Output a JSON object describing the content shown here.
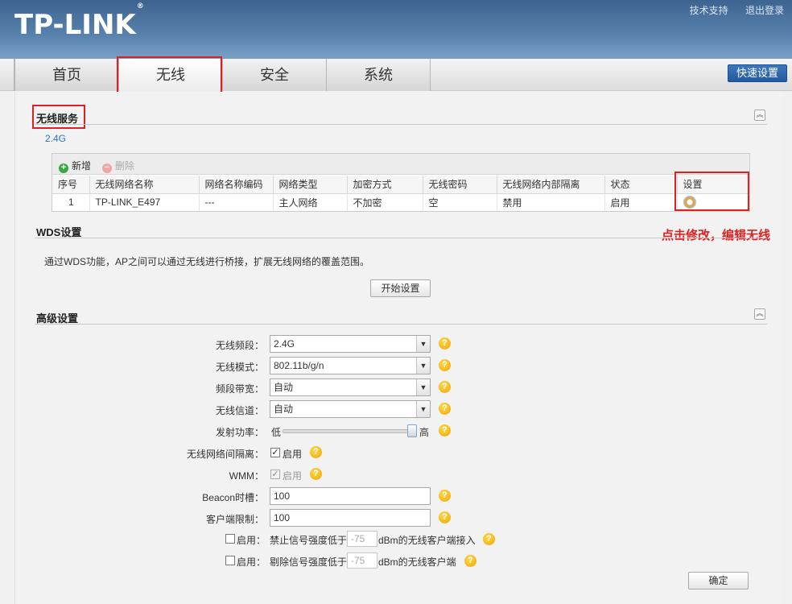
{
  "header": {
    "logo": "TP-LINK",
    "logo_mark": "®",
    "links": [
      "技术支持",
      "退出登录"
    ]
  },
  "nav": {
    "tabs": [
      "首页",
      "无线",
      "安全",
      "系统"
    ],
    "active": "无线",
    "quick_setup": "快速设置"
  },
  "wireless_service": {
    "title": "无线服务",
    "band": "2.4G",
    "toolbar": {
      "add": "新增",
      "delete": "删除"
    },
    "columns": [
      "序号",
      "无线网络名称",
      "网络名称编码",
      "网络类型",
      "加密方式",
      "无线密码",
      "无线网络内部隔离",
      "状态",
      "设置"
    ],
    "rows": [
      {
        "index": "1",
        "ssid": "TP-LINK_E497",
        "ssid_encoding": "---",
        "network_type": "主人网络",
        "encryption": "不加密",
        "password": "空",
        "isolation": "禁用",
        "status": "启用"
      }
    ]
  },
  "annotation": "点击修改，编辑无线",
  "wds": {
    "title": "WDS设置",
    "description": "通过WDS功能，AP之间可以通过无线进行桥接，扩展无线网络的覆盖范围。",
    "start_button": "开始设置"
  },
  "advanced": {
    "title": "高级设置",
    "band_label": "无线频段：",
    "band_value": "2.4G",
    "mode_label": "无线模式：",
    "mode_value": "802.11b/g/n",
    "width_label": "频段带宽：",
    "width_value": "自动",
    "channel_label": "无线信道：",
    "channel_value": "自动",
    "power_label": "发射功率：",
    "power_low": "低",
    "power_high": "高",
    "power_level": 0.95,
    "isolation_label": "无线网络间隔离：",
    "isolation_enabled": true,
    "isolation_text": "启用",
    "wmm_label": "WMM：",
    "wmm_enabled": true,
    "wmm_text": "启用",
    "beacon_label": "Beacon时槽：",
    "beacon_value": "100",
    "client_limit_label": "客户端限制：",
    "client_limit_value": "100",
    "reject_enable_text": "启用：",
    "reject_text_a": "禁止信号强度低于",
    "reject_value": "-75",
    "reject_text_b": "dBm的无线客户端接入",
    "kick_enable_text": "启用：",
    "kick_text_a": "剔除信号强度低于",
    "kick_value": "-75",
    "kick_text_b": "dBm的无线客户端",
    "confirm_button": "确定"
  },
  "colors": {
    "header": "#4a73a0",
    "accent_link": "#2a78c4",
    "annotation": "#e02020",
    "quick_setup": "#2d65aa"
  },
  "icons": {
    "collapse": "collapse-up-icon",
    "add": "add-circle-icon",
    "delete": "delete-circle-icon",
    "settings": "gear-icon",
    "help": "help-icon"
  }
}
